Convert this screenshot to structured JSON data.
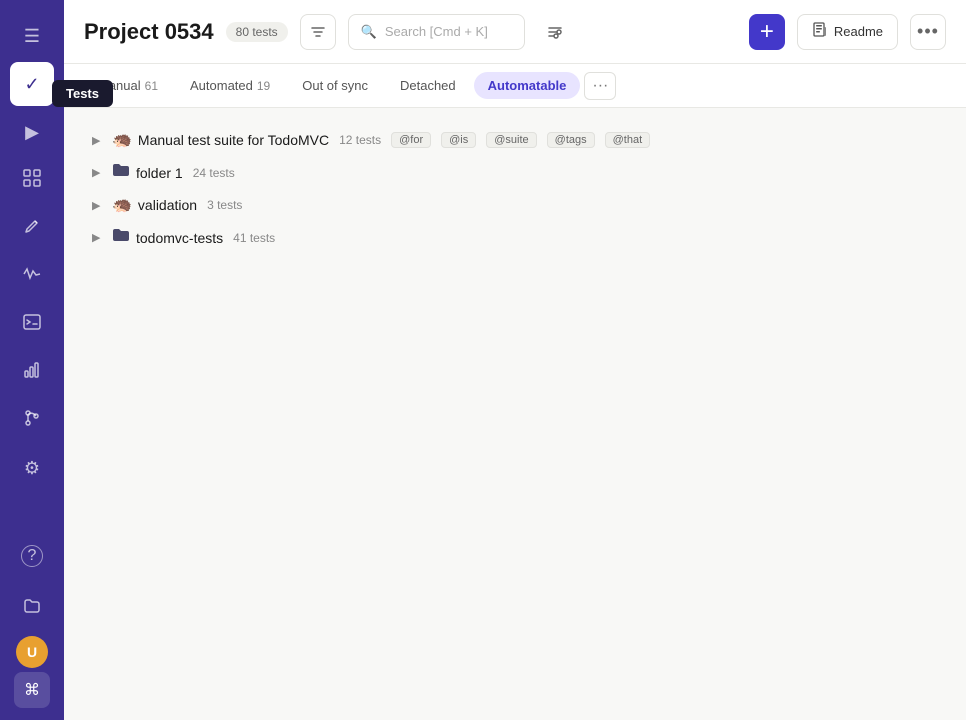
{
  "sidebar": {
    "items": [
      {
        "name": "menu",
        "icon": "☰",
        "active": false
      },
      {
        "name": "tests",
        "icon": "✓",
        "active": true,
        "label": "Tests"
      },
      {
        "name": "play",
        "icon": "▶",
        "active": false
      },
      {
        "name": "dashboard",
        "icon": "◫",
        "active": false
      },
      {
        "name": "edit",
        "icon": "✏",
        "active": false
      },
      {
        "name": "activity",
        "icon": "〜",
        "active": false
      },
      {
        "name": "terminal",
        "icon": "⬛",
        "active": false
      },
      {
        "name": "chart",
        "icon": "▦",
        "active": false
      },
      {
        "name": "branch",
        "icon": "⑂",
        "active": false
      },
      {
        "name": "settings",
        "icon": "⚙",
        "active": false
      },
      {
        "name": "help",
        "icon": "?",
        "active": false
      },
      {
        "name": "folder",
        "icon": "📁",
        "active": false
      }
    ],
    "avatar_initials": "U",
    "kbd_symbol": "⌘"
  },
  "header": {
    "project_title": "Project 0534",
    "test_count": "80 tests",
    "filter_icon": "▼",
    "search_placeholder": "Search [Cmd + K]",
    "settings_icon": "⊞",
    "add_label": "+",
    "readme_icon": "📄",
    "readme_label": "Readme",
    "more_label": "•••"
  },
  "tabs": [
    {
      "id": "manual",
      "label": "Manual",
      "count": "61",
      "active": false
    },
    {
      "id": "automated",
      "label": "Automated",
      "count": "19",
      "active": false
    },
    {
      "id": "out-of-sync",
      "label": "Out of sync",
      "count": "",
      "active": false
    },
    {
      "id": "detached",
      "label": "Detached",
      "count": "",
      "active": false
    },
    {
      "id": "automatable",
      "label": "Automatable",
      "count": "",
      "active": true
    },
    {
      "id": "more",
      "label": "...",
      "active": false
    }
  ],
  "tree": [
    {
      "id": "manual-suite",
      "icon": "🦔",
      "name": "Manual test suite for TodoMVC",
      "count": "12 tests",
      "tags": [
        "@for",
        "@is",
        "@suite",
        "@tags",
        "@that"
      ]
    },
    {
      "id": "folder1",
      "icon": "📁",
      "name": "folder 1",
      "count": "24 tests",
      "tags": []
    },
    {
      "id": "validation",
      "icon": "🦔",
      "name": "validation",
      "count": "3 tests",
      "tags": []
    },
    {
      "id": "todomvc-tests",
      "icon": "📁",
      "name": "todomvc-tests",
      "count": "41 tests",
      "tags": []
    }
  ]
}
